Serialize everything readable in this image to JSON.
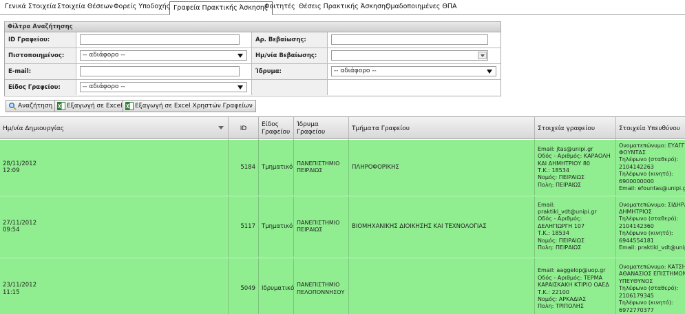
{
  "tabs": [
    {
      "label": "Γενικά Στοιχεία"
    },
    {
      "label": "Στοιχεία Θέσεων"
    },
    {
      "label": "Φορείς Υποδοχής"
    },
    {
      "label": "Γραφεία Πρακτικής Άσκησης",
      "active": true
    },
    {
      "label": "Φοιτητές"
    },
    {
      "label": "Θέσεις Πρακτικής Άσκησης"
    },
    {
      "label": "Ομαδοποιημένες ΘΠΑ"
    }
  ],
  "filters": {
    "title": "Φίλτρα Αναζήτησης",
    "office_id_label": "ID Γραφείου:",
    "office_id_value": "",
    "cert_no_label": "Αρ. Βεβαίωσης:",
    "cert_no_value": "",
    "certified_label": "Πιστοποιημένος:",
    "certified_value": "-- αδιάφορο --",
    "cert_date_label": "Ημ/νία Βεβαίωσης:",
    "cert_date_value": "",
    "email_label": "E-mail:",
    "email_value": "",
    "institution_label": "Ίδρυμα:",
    "institution_value": "-- αδιάφορο --",
    "office_type_label": "Είδος Γραφείου:",
    "office_type_value": "-- αδιάφορο --"
  },
  "buttons": {
    "search": "Αναζήτηση",
    "export_excel": "Εξαγωγή σε Excel",
    "export_excel_users": "Εξαγωγή σε Excel Χρηστών Γραφείων"
  },
  "grid": {
    "columns": {
      "created": "Ημ/νία Δημιουργίας",
      "id": "ID",
      "type": "Είδος\nΓραφείου",
      "institution": "Ίδρυμα\nΓραφείου",
      "departments": "Τμήματα Γραφείου",
      "office_info": "Στοιχεία γραφείου",
      "manager_info": "Στοιχεία Υπευθύνου"
    },
    "rows": [
      {
        "date": "28/11/2012",
        "time": "12:09",
        "id": "5184",
        "type": "Τμηματικό",
        "institution": "ΠΑΝΕΠΙΣΤΗΜΙΟ\nΠΕΙΡΑΙΩΣ",
        "departments": "ΠΛΗΡΟΦΟΡΙΚΗΣ",
        "office_info": "Email: jtas@unipi.gr\nΟδός - Αριθμός: ΚΑΡΑΟΛΗ\nΚΑΙ ΔΗΜΗΤΡΙΟΥ 80\nΤ.Κ.: 18534\nΝομός: ΠΕΙΡΑΙΩΣ\nΠολη: ΠΕΙΡΑΙΩΣ",
        "manager_info": "Ονοματεπώνυμο: ΕΥΑΓΓΕ\nΦΟΥΝΤΑΣ\nΤηλέφωνο (σταθερό):\n2104142263\nΤηλέφωνο (κινητό):\n6900000000\nEmail: efountas@unipi.gr"
      },
      {
        "date": "27/11/2012",
        "time": "09:54",
        "id": "5117",
        "type": "Τμηματικό",
        "institution": "ΠΑΝΕΠΙΣΤΗΜΙΟ\nΠΕΙΡΑΙΩΣ",
        "departments": "ΒΙΟΜΗΧΑΝΙΚΗΣ ΔΙΟΙΚΗΣΗΣ ΚΑΙ ΤΕΧΝΟΛΟΓΙΑΣ",
        "office_info": "Email: praktiki_vdt@unipi.gr\nΟδός - Αριθμός:\nΔΕΛΗΓΙΩΡΓΗ 107\nΤ.Κ.: 18534\nΝομός: ΠΕΙΡΑΙΩΣ\nΠολη: ΠΕΙΡΑΙΩΣ",
        "manager_info": "Ονοματεπώνυμο: ΣΙΔΗΡΑ\nΔΗΜΗΤΡΙΟΣ\nΤηλέφωνο (σταθερό):\n2104142360\nΤηλέφωνο (κινητό):\n6944554181\nEmail: praktiki_vdt@unipi"
      },
      {
        "date": "23/11/2012",
        "time": "11:15",
        "id": "5049",
        "type": "Ιδρυματικό",
        "institution": "ΠΑΝΕΠΙΣΤΗΜΙΟ\nΠΕΛΟΠΟΝΝΗΣΟΥ",
        "departments": "",
        "office_info": "Email: aaggelop@uop.gr\nΟδός - Αριθμός: ΤΕΡΜΑ\nΚΑΡΑΙΣΚΑΚΗ ΚΤΙΡΙΟ ΟΑΕΔ\nΤ.Κ.: 22100\nΝομός: ΑΡΚΑΔΙΑΣ\nΠολη: ΤΡΙΠΟΛΗΣ",
        "manager_info": "Ονοματεπώνυμο: ΚΑΤΣΗ\nΑΘΑΝΑΣΙΟΣ ΕΠΙΣΤΗΜΟΝ\nΥΠΕΥΘΥΝΟΣ\nΤηλέφωνο (σταθερό):\n2106179345\nΤηλέφωνο (κινητό):\n6972770377"
      }
    ]
  }
}
